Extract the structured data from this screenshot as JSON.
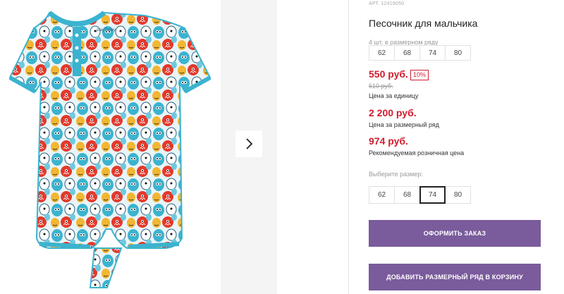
{
  "product": {
    "article_label": "АРТ.",
    "article_value": "12419050",
    "title": "Песочник для мальчика",
    "sizes_in_row_note": "4 шт. в размерном ряду",
    "row_sizes": [
      "62",
      "68",
      "74",
      "80"
    ],
    "price": "550 руб.",
    "discount": "10%",
    "old_price": "610 руб.",
    "unit_price_label": "Цена за единицу",
    "row_price": "2 200 руб.",
    "row_price_label": "Цена за размерный ряд",
    "rrp": "974 руб.",
    "rrp_label": "Рекомендуемая розничная цена",
    "choose_size_label": "Выберите размер:",
    "selectable_sizes": [
      "62",
      "68",
      "74",
      "80"
    ],
    "selected_size": "74"
  },
  "buttons": {
    "order": "ОФОРМИТЬ ЗАКАЗ",
    "add_row": "ДОБАВИТЬ РАЗМЕРНЫЙ РЯД В КОРЗИНУ"
  },
  "image": {
    "brand_text": "playToday",
    "next_icon": "chevron-right-icon"
  },
  "colors": {
    "accent_price": "#d01d2e",
    "button": "#7a5b9c",
    "romper_base": "#3bb3cf"
  }
}
